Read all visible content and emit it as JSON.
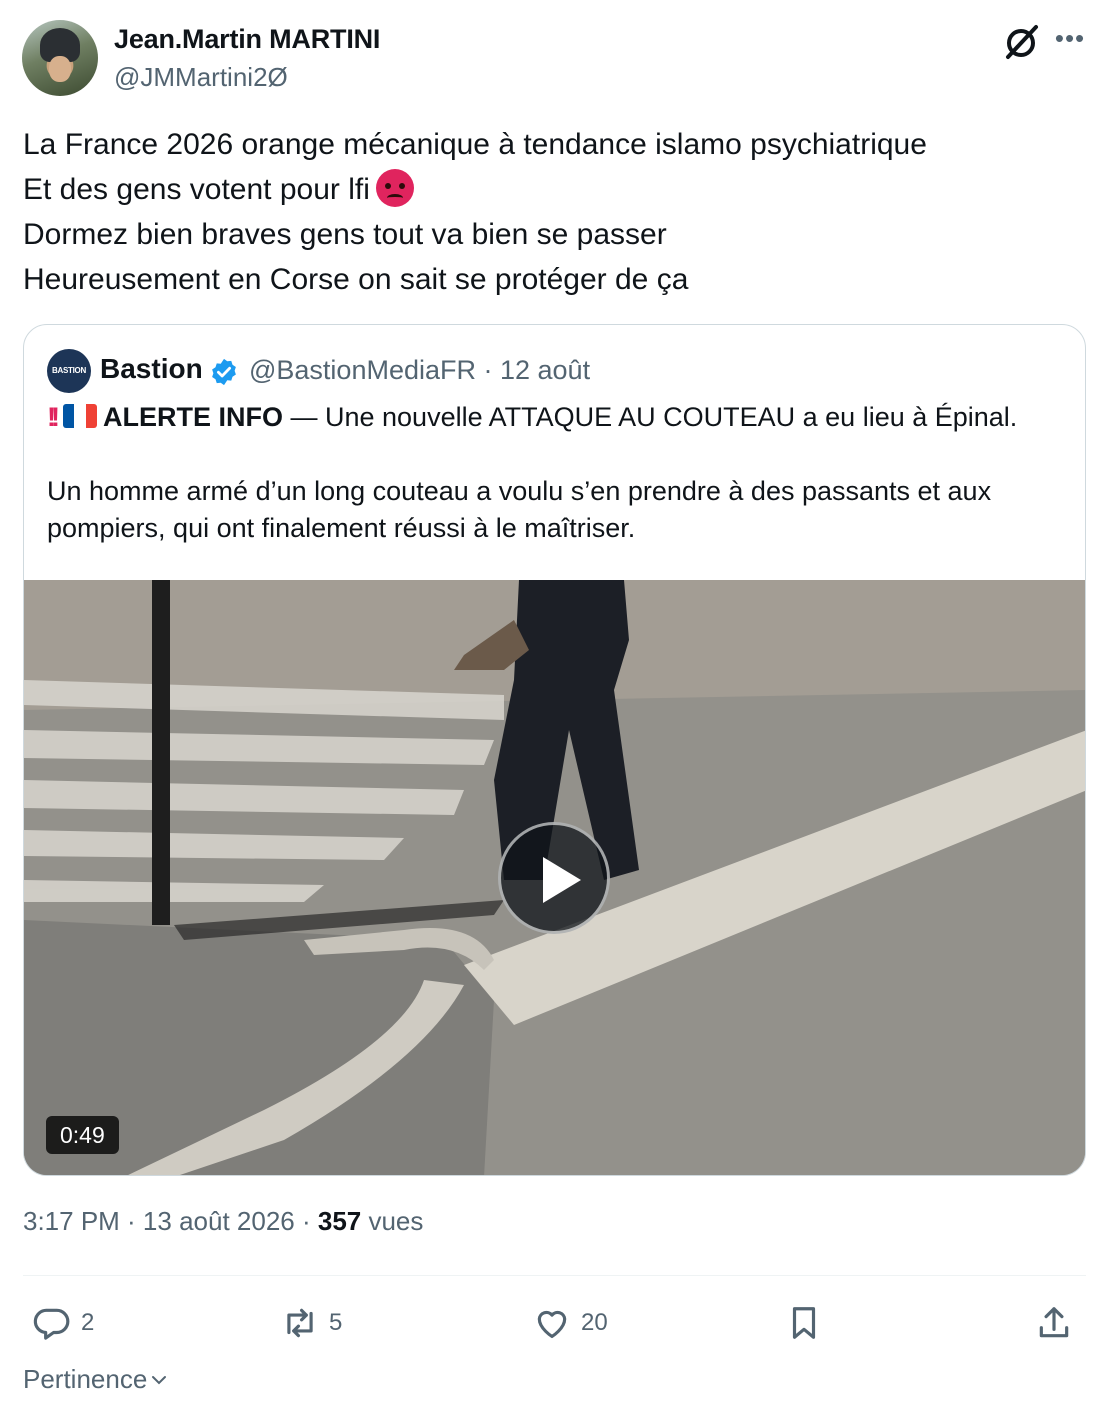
{
  "author": {
    "name": "Jean.Martin MARTINI",
    "handle": "@JMMartini2Ø"
  },
  "tweet": {
    "lines": [
      "La France 2026 orange mécanique à tendance islamo psychiatrique",
      "Et des gens votent pour lfi",
      "Dormez bien braves gens tout va bien se passer",
      "Heureusement en Corse on sait se protéger de ça"
    ],
    "emoji": "angry-face"
  },
  "quote": {
    "avatar_text": "BASTION",
    "name": "Bastion",
    "handle_date": "@BastionMediaFR · 12 août",
    "alert_label": "ALERTE INFO",
    "alert_rest": " — Une nouvelle ATTAQUE AU COUTEAU a eu lieu à Épinal.",
    "body": "Un homme armé d’un long couteau a voulu s’en prendre à des passants et aux pompiers, qui ont finalement réussi à le maîtriser.",
    "video_duration": "0:49"
  },
  "meta": {
    "time_date": "3:17 PM · 13 août 2026 · ",
    "views_count": "357",
    "views_label": " vues"
  },
  "actions": {
    "replies": "2",
    "reposts": "5",
    "likes": "20"
  },
  "sort": {
    "label": "Pertinence"
  },
  "colors": {
    "text": "#0f1419",
    "secondary": "#536471",
    "verified": "#1d9bf0",
    "border": "#cfd9de"
  }
}
